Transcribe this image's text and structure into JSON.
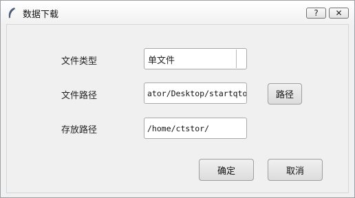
{
  "window": {
    "title": "数据下载",
    "help_label": "?",
    "close_label": "✕"
  },
  "form": {
    "file_type_label": "文件类型",
    "file_type_value": "单文件",
    "file_path_label": "文件路径",
    "file_path_value": "ator/Desktop/startqtouch",
    "browse_label": "路径",
    "save_path_label": "存放路径",
    "save_path_value": "/home/ctstor/"
  },
  "actions": {
    "ok_label": "确定",
    "cancel_label": "取消"
  },
  "icons": {
    "app": "feather-icon",
    "combo_arrow": "dropdown-arrow-icon"
  }
}
